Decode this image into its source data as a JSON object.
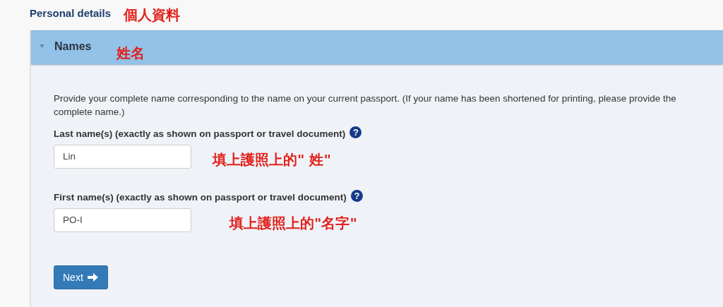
{
  "section": {
    "title": "Personal details",
    "annotation": "個人資料"
  },
  "panel": {
    "title": "Names",
    "expanded": true,
    "annotation": "姓名"
  },
  "intro": "Provide your complete name corresponding to the name on your current passport. (If your name has been shortened for printing, please provide the complete name.)",
  "fields": [
    {
      "label": "Last name(s) (exactly as shown on passport or travel document)",
      "help": "?",
      "value": "Lin",
      "annotation": "填上護照上的\" 姓\""
    },
    {
      "label": "First name(s) (exactly as shown on passport or travel document)",
      "help": "?",
      "value": "PO-I",
      "annotation": "填上護照上的\"名字\""
    }
  ],
  "next_button": {
    "label": "Next"
  }
}
